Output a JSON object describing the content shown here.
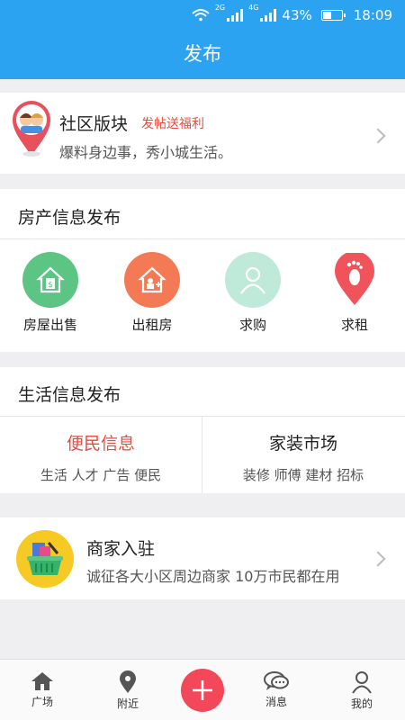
{
  "status_bar": {
    "network_label": "2G",
    "network_label_2": "4G",
    "battery": "43%",
    "time": "18:09"
  },
  "header": {
    "title": "发布"
  },
  "community": {
    "title": "社区版块",
    "promo": "发帖送福利",
    "subtitle": "爆料身边事，秀小城生活。"
  },
  "house_section": {
    "title": "房产信息发布",
    "items": [
      {
        "label": "房屋出售",
        "color": "#5cc583",
        "icon": "house-dollar-icon"
      },
      {
        "label": "出租房",
        "color": "#f37a54",
        "icon": "house-key-icon"
      },
      {
        "label": "求购",
        "color": "#bfe9d9",
        "icon": "person-icon"
      },
      {
        "label": "求租",
        "color": "#f0545a",
        "icon": "footprint-icon"
      }
    ]
  },
  "life_section": {
    "title": "生活信息发布",
    "columns": [
      {
        "title": "便民信息",
        "subtitle": "生活 人才 广告 便民",
        "color": "#e94b3c"
      },
      {
        "title": "家装市场",
        "subtitle": "装修 师傅 建材 招标",
        "color": "#222222"
      }
    ]
  },
  "merchant": {
    "title": "商家入驻",
    "subtitle": "诚征各大小区周边商家 10万市民都在用"
  },
  "tabbar": {
    "tabs": [
      {
        "label": "广场",
        "icon": "home-icon"
      },
      {
        "label": "附近",
        "icon": "location-icon"
      },
      {
        "label": "消息",
        "icon": "message-icon"
      },
      {
        "label": "我的",
        "icon": "user-icon"
      }
    ],
    "post_icon": "plus-icon"
  },
  "colors": {
    "brand_blue": "#2ba3f0",
    "accent_red": "#e94b3c",
    "post_button": "#f2485a"
  }
}
